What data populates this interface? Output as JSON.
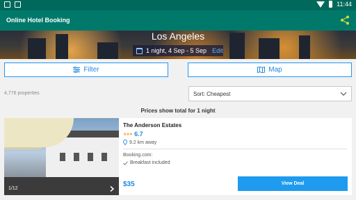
{
  "status_bar": {
    "time": "11:44"
  },
  "app_bar": {
    "title": "Online Hotel Booking",
    "share_icon": "share-icon"
  },
  "hero": {
    "city": "Los Angeles",
    "dates": "1 night, 4 Sep - 5 Sep",
    "edit_label": "Edit"
  },
  "actions": {
    "filter_label": "Filter",
    "map_label": "Map"
  },
  "results": {
    "count_label": "4,776 properties",
    "sort_label": "Sort: Cheapest",
    "prices_note": "Prices show total for 1 night"
  },
  "hotel": {
    "name": "The Anderson Estates",
    "stars": 3,
    "stars_text": "★★★",
    "rating": "6.7",
    "distance": "9.2 km away",
    "provider": "Booking.com:",
    "amenity": "Breakfast included",
    "price": "$35",
    "deal_label": "View Deal",
    "photo_counter": "1/12"
  },
  "colors": {
    "app_bar": "#00796b",
    "status_bar": "#00695c",
    "accent": "#1e88e5",
    "deal_button": "#1e9bee",
    "stars": "#f5a623"
  }
}
